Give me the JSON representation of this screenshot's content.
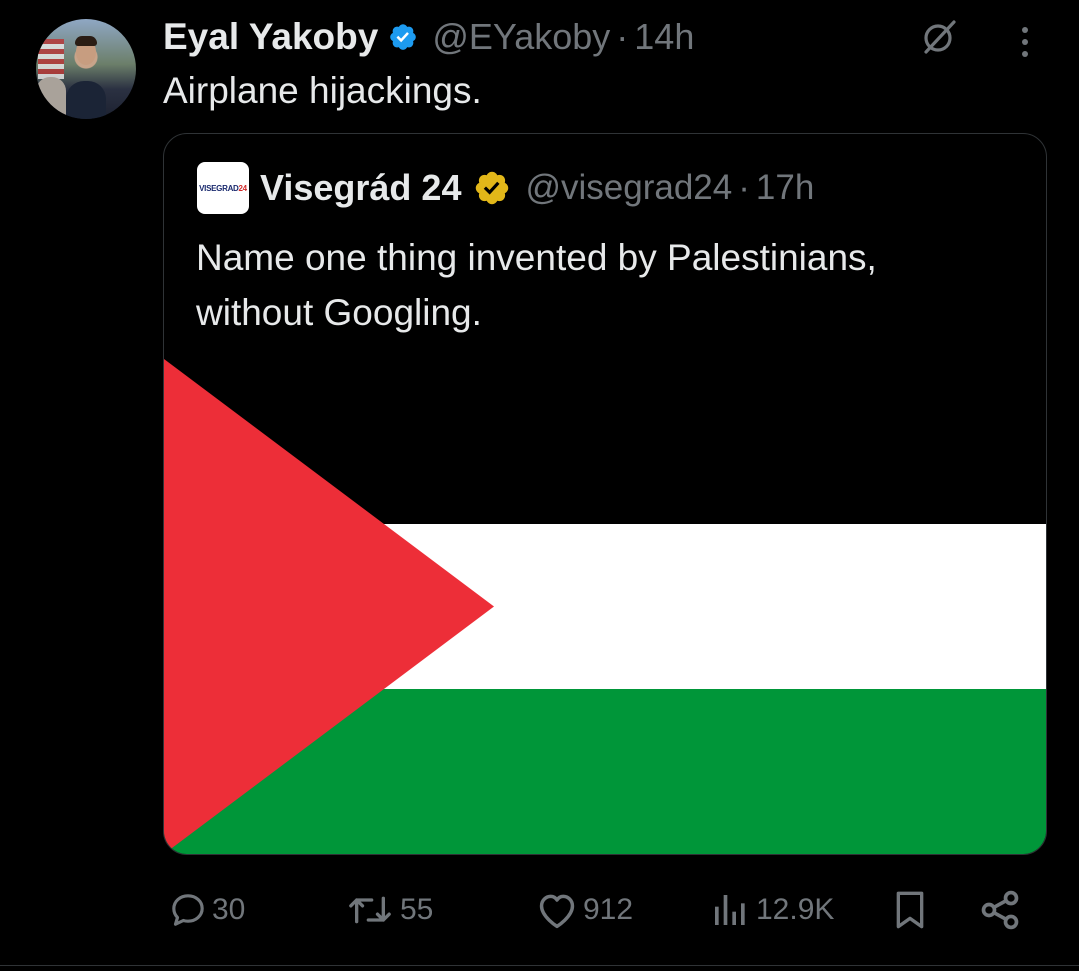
{
  "tweet": {
    "author_name": "Eyal Yakoby",
    "handle": "@EYakoby",
    "separator": "·",
    "time": "14h",
    "text": "Airplane hijackings."
  },
  "quoted_tweet": {
    "avatar_logo": "VISEGRAD24",
    "author_name": "Visegrád 24",
    "handle": "@visegrad24",
    "separator": "·",
    "time": "17h",
    "text_line1": "Name one thing invented by Palestinians,",
    "text_line2": "without Googling.",
    "image": {
      "description_icon": "palestinian-flag",
      "colors": {
        "top": "#000000",
        "middle": "#ffffff",
        "bottom": "#009639",
        "triangle": "#ed2e38"
      }
    }
  },
  "actions": {
    "replies": "30",
    "reposts": "55",
    "likes": "912",
    "views": "12.9K"
  },
  "colors": {
    "background": "#000000",
    "text_primary": "#e7e9ea",
    "text_secondary": "#71767b",
    "verified_blue": "#1d9bf0",
    "verified_gold": "#e2b719",
    "border": "#2f3336"
  },
  "icons": {
    "grok": "grok-icon",
    "more": "more-icon",
    "reply": "reply-icon",
    "repost": "repost-icon",
    "like": "like-icon",
    "views": "views-icon",
    "bookmark": "bookmark-icon",
    "share": "share-icon"
  }
}
